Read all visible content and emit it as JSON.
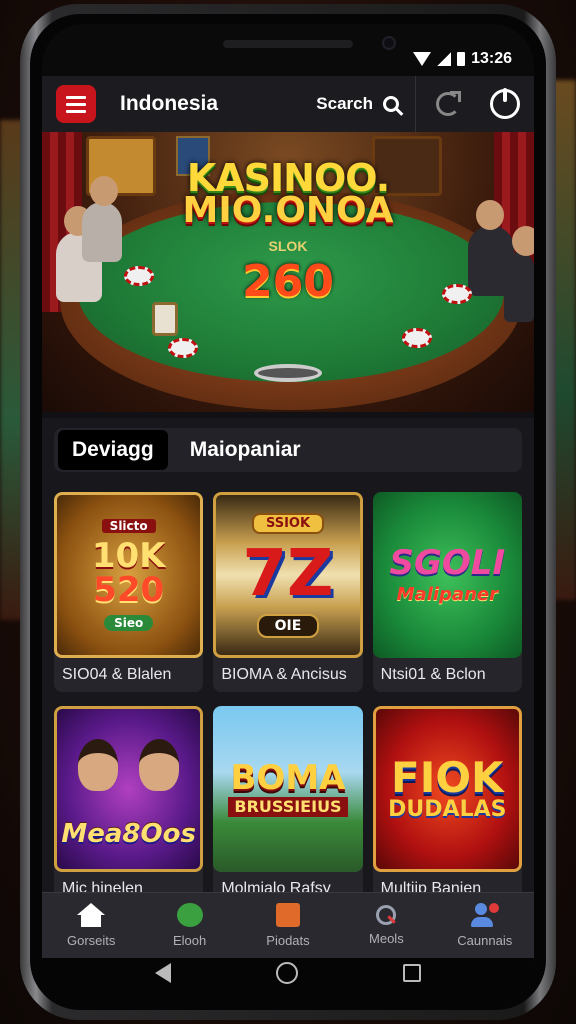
{
  "status_bar": {
    "time": "13:26"
  },
  "header": {
    "title": "Indonesia",
    "search_label": "Scarch",
    "brand_color": "#c8141c"
  },
  "hero": {
    "title_line1": "KASINOO.",
    "title_line2": "MIO.ONOA",
    "subtitle": "SLOK",
    "number": "260"
  },
  "tabs": [
    {
      "label": "Deviagg",
      "active": true
    },
    {
      "label": "Maiopaniar",
      "active": false
    }
  ],
  "games": [
    {
      "label": "SIO04 & Blalen",
      "art": {
        "top": "Slicto",
        "line1": "10K",
        "line2": "520",
        "button": "Sieo"
      }
    },
    {
      "label": "BIOMA & Ancisus",
      "art": {
        "top": "SSIOK",
        "line1": "7Z",
        "button": "OIE"
      }
    },
    {
      "label": "Ntsi01 & Bclon",
      "art": {
        "line1": "SGOLI",
        "line2": "Malipaner"
      }
    },
    {
      "label": "Mic hinelen",
      "art": {
        "line1": "Mea8Oos"
      }
    },
    {
      "label": "Molmialo Rafsy",
      "art": {
        "line1": "BOMA",
        "line2": "BRUSSIEIUS"
      }
    },
    {
      "label": "Multiip Banien",
      "art": {
        "line1": "FIOK",
        "line2": "DUDALAS"
      }
    }
  ],
  "bottom_nav": [
    {
      "label": "Gorseits",
      "icon": "home-icon"
    },
    {
      "label": "Elooh",
      "icon": "chat-icon"
    },
    {
      "label": "Piodats",
      "icon": "box-icon"
    },
    {
      "label": "Meols",
      "icon": "search-icon"
    },
    {
      "label": "Caunnais",
      "icon": "users-icon"
    }
  ]
}
